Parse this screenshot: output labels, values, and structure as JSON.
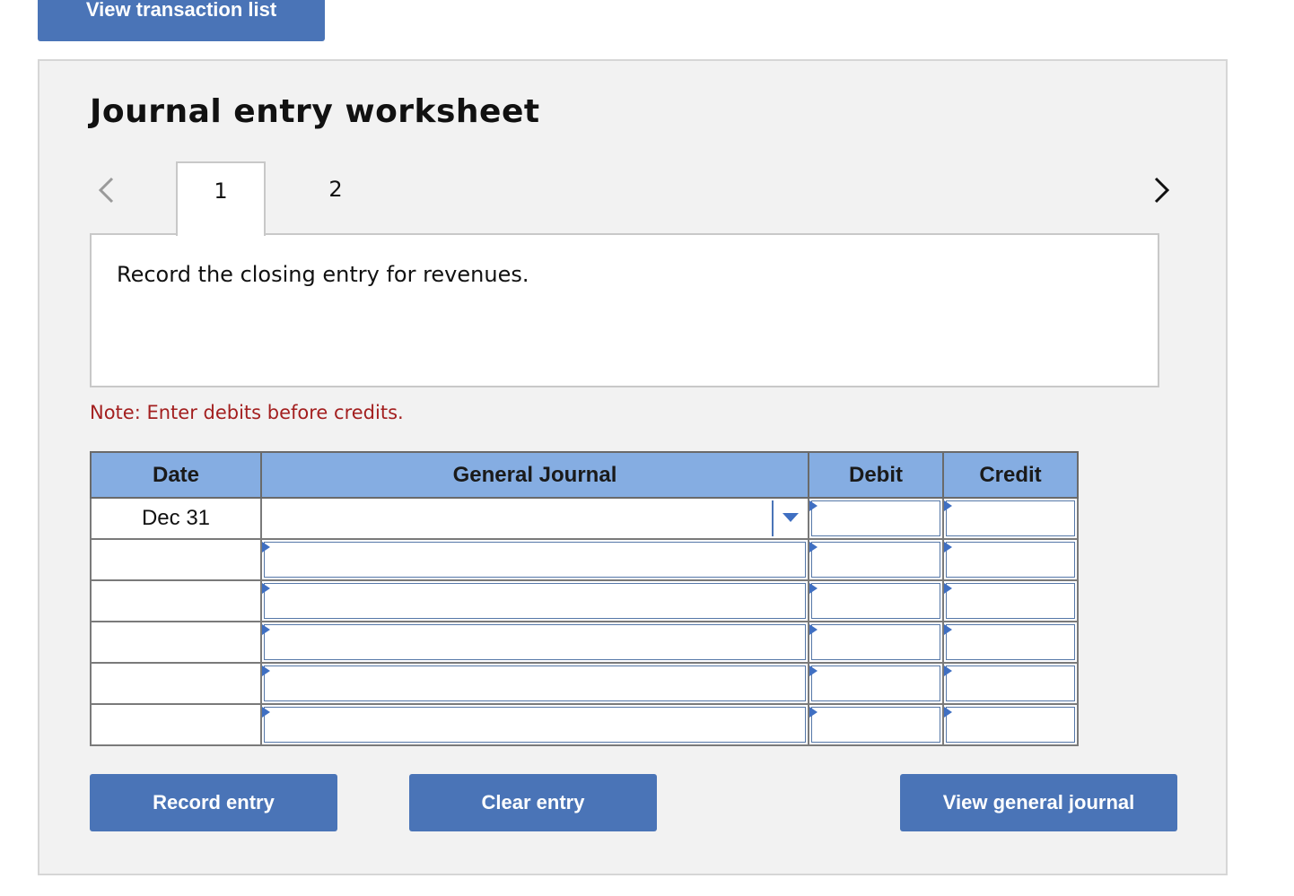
{
  "top_button": {
    "label": "View transaction list"
  },
  "worksheet": {
    "title": "Journal entry worksheet",
    "tabs": [
      {
        "label": "1",
        "active": true
      },
      {
        "label": "2",
        "active": false
      }
    ],
    "prompt": "Record the closing entry for revenues.",
    "note": "Note: Enter debits before credits."
  },
  "table": {
    "headers": {
      "date": "Date",
      "general_journal": "General Journal",
      "debit": "Debit",
      "credit": "Credit"
    },
    "rows": [
      {
        "date": "Dec 31",
        "account": "",
        "debit": "",
        "credit": ""
      },
      {
        "date": "",
        "account": "",
        "debit": "",
        "credit": ""
      },
      {
        "date": "",
        "account": "",
        "debit": "",
        "credit": ""
      },
      {
        "date": "",
        "account": "",
        "debit": "",
        "credit": ""
      },
      {
        "date": "",
        "account": "",
        "debit": "",
        "credit": ""
      },
      {
        "date": "",
        "account": "",
        "debit": "",
        "credit": ""
      }
    ]
  },
  "buttons": {
    "record": "Record entry",
    "clear": "Clear entry",
    "view_general_journal": "View general journal"
  },
  "colors": {
    "button_blue": "#4a74b7",
    "header_blue": "#85ade2",
    "note_red": "#a31f1f",
    "panel_gray": "#f2f2f2"
  },
  "icons": {
    "prev": "chevron-left-icon",
    "next": "chevron-right-icon",
    "dropdown": "dropdown-arrow-icon"
  }
}
